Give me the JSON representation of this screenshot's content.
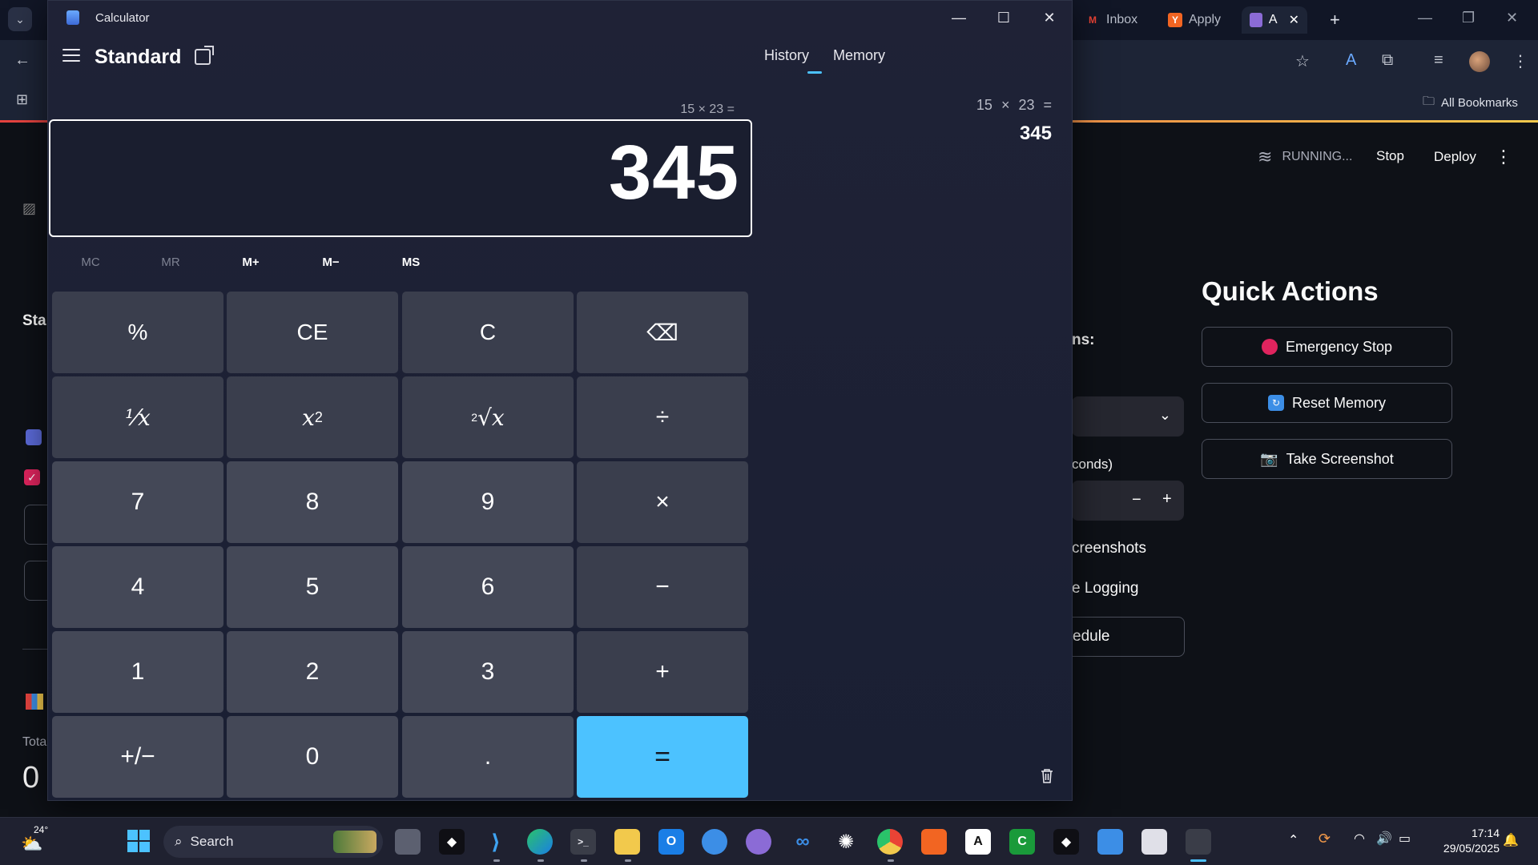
{
  "browser": {
    "tabs": [
      {
        "label": "Inbox",
        "favicon": "gmail-icon",
        "color": "#ea4335"
      },
      {
        "label": "Apply",
        "favicon": "y-combinator-icon",
        "color": "#f26522"
      },
      {
        "label": "A",
        "favicon": "app-icon",
        "color": "#8b6bd6"
      }
    ],
    "new_tab": "+",
    "bookmarks_label": "All Bookmarks"
  },
  "streamlit": {
    "status": "RUNNING...",
    "stop_label": "Stop",
    "deploy_label": "Deploy",
    "left_labels": {
      "stat": "Sta",
      "total": "Tota",
      "total_value": "0"
    },
    "partial_labels": {
      "ns": "ns:",
      "seconds": "conds)",
      "screenshots": "creenshots",
      "logging": "e Logging",
      "schedule": "edule"
    },
    "stepper_minus": "−",
    "stepper_plus": "+",
    "quick_actions": {
      "title": "Quick Actions",
      "buttons": [
        {
          "label": "Emergency Stop",
          "icon": "red-circle-icon"
        },
        {
          "label": "Reset Memory",
          "icon": "refresh-icon"
        },
        {
          "label": "Take Screenshot",
          "icon": "camera-icon"
        }
      ]
    }
  },
  "calculator": {
    "window_title": "Calculator",
    "mode": "Standard",
    "pane_tabs": {
      "history": "History",
      "memory": "Memory"
    },
    "expression": "15 × 23 =",
    "display": "345",
    "memory_buttons": [
      "MC",
      "MR",
      "M+",
      "M−",
      "MS"
    ],
    "keys": {
      "percent": "%",
      "ce": "CE",
      "c": "C",
      "backspace": "⌫",
      "reciprocal": "¹⁄x",
      "square_base": "x",
      "square_exp": "2",
      "sqrt_idx": "2",
      "sqrt": "√x",
      "divide": "÷",
      "k7": "7",
      "k8": "8",
      "k9": "9",
      "multiply": "×",
      "k4": "4",
      "k5": "5",
      "k6": "6",
      "minus": "−",
      "k1": "1",
      "k2": "2",
      "k3": "3",
      "plus": "+",
      "negate": "+/−",
      "k0": "0",
      "dot": ".",
      "equals": "="
    },
    "history": {
      "expression": "15 × 23 =",
      "result": "345"
    }
  },
  "taskbar": {
    "weather_temp": "24°",
    "search_placeholder": "Search",
    "time": "17:14",
    "date": "29/05/2025"
  }
}
